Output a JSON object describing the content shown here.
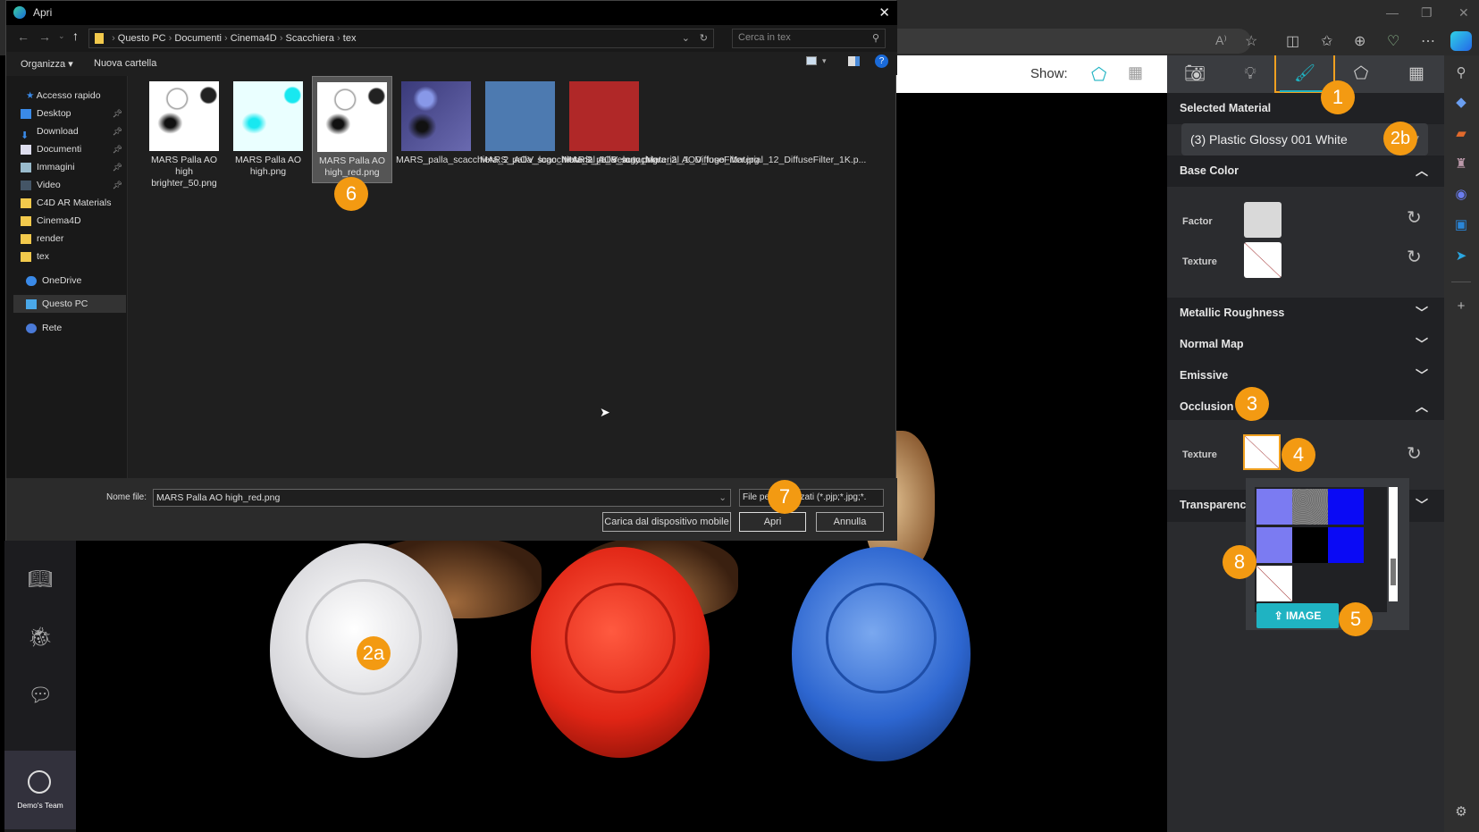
{
  "browser": {
    "toolbar_icons": [
      "read-aloud-icon",
      "favorite-star-icon",
      "split-screen-icon",
      "favorites-list-icon",
      "collections-icon",
      "browser-essentials-icon",
      "more-icon",
      "copilot-icon"
    ],
    "sidebar_icons": [
      "search-icon",
      "shopping-tag-icon",
      "tools-icon",
      "games-icon",
      "copilot-app-icon",
      "outlook-icon",
      "telegram-icon",
      "add-icon",
      "settings-icon"
    ]
  },
  "dialog": {
    "title": "Apri",
    "breadcrumb": [
      "Questo PC",
      "Documenti",
      "Cinema4D",
      "Scacchiera",
      "tex"
    ],
    "search_placeholder": "Cerca in tex",
    "organize_label": "Organizza",
    "new_folder_label": "Nuova cartella",
    "nav": {
      "quick_access": "Accesso rapido",
      "items": [
        {
          "label": "Desktop",
          "icon": "desktop-icon",
          "pinned": true
        },
        {
          "label": "Download",
          "icon": "download-icon",
          "pinned": true
        },
        {
          "label": "Documenti",
          "icon": "documents-icon",
          "pinned": true
        },
        {
          "label": "Immagini",
          "icon": "pictures-icon",
          "pinned": true
        },
        {
          "label": "Video",
          "icon": "video-icon",
          "pinned": true
        },
        {
          "label": "C4D AR Materials",
          "icon": "folder-icon",
          "pinned": false
        },
        {
          "label": "Cinema4D",
          "icon": "folder-icon",
          "pinned": false
        },
        {
          "label": "render",
          "icon": "folder-icon",
          "pinned": false
        },
        {
          "label": "tex",
          "icon": "folder-icon",
          "pinned": false
        }
      ],
      "onedrive": "OneDrive",
      "this_pc": "Questo PC",
      "network": "Rete"
    },
    "files": [
      {
        "name": "MARS Palla AO high brighter_50.png",
        "thumb": "ao-white"
      },
      {
        "name": "MARS Palla AO high.png",
        "thumb": "ao-cyan"
      },
      {
        "name": "MARS Palla AO high_red.png",
        "thumb": "ao-white",
        "selected": true
      },
      {
        "name": "MARS_palla_scacchiera_2_AOV_logo_Material_1_Beauty.png",
        "thumb": "beauty"
      },
      {
        "name": "MARS_palla_scacchiera_2_AOV_logo_Material_1_DiffuseFilter.jpg",
        "thumb": "blue"
      },
      {
        "name": "MARS_palla_scacchiera_2_AOV_logo_Material_12_DiffuseFilter_1K.p...",
        "thumb": "red"
      }
    ],
    "filename_label": "Nome file:",
    "filename_value": "MARS Palla AO high_red.png",
    "filetype_value": "File personalizzati (*.pjp;*.jpg;*.",
    "mobile_button": "Carica dal dispositivo mobile",
    "open_button": "Apri",
    "cancel_button": "Annulla"
  },
  "viewer": {
    "show_label": "Show:",
    "team_label": "Demo's Team"
  },
  "panel": {
    "tabs": [
      "camera",
      "lighting",
      "materials",
      "tags",
      "scene"
    ],
    "active_tab": "materials",
    "selected_material_label": "Selected Material",
    "selected_material_value": "(3) Plastic Glossy 001 White",
    "base_color": {
      "title": "Base Color",
      "factor_label": "Factor",
      "texture_label": "Texture",
      "factor_color": "#d9d9d9"
    },
    "sections": [
      "Metallic Roughness",
      "Normal Map",
      "Emissive"
    ],
    "occlusion": {
      "title": "Occlusion",
      "texture_label": "Texture"
    },
    "transparency": "Transparency",
    "texture_picker": {
      "swatches": [
        "#7b7bf2",
        "noise-gray",
        "#0a0af5",
        "#7b7bf2",
        "#000000",
        "#0a0af5",
        "none"
      ],
      "upload_label": "IMAGE"
    }
  },
  "annotations": {
    "b1": "1",
    "b2a": "2a",
    "b2b": "2b",
    "b3": "3",
    "b4": "4",
    "b5": "5",
    "b6": "6",
    "b7": "7",
    "b8": "8"
  },
  "colors": {
    "accent": "#1fb3c2",
    "badge": "#f39a12",
    "highlight": "#f0a020"
  }
}
